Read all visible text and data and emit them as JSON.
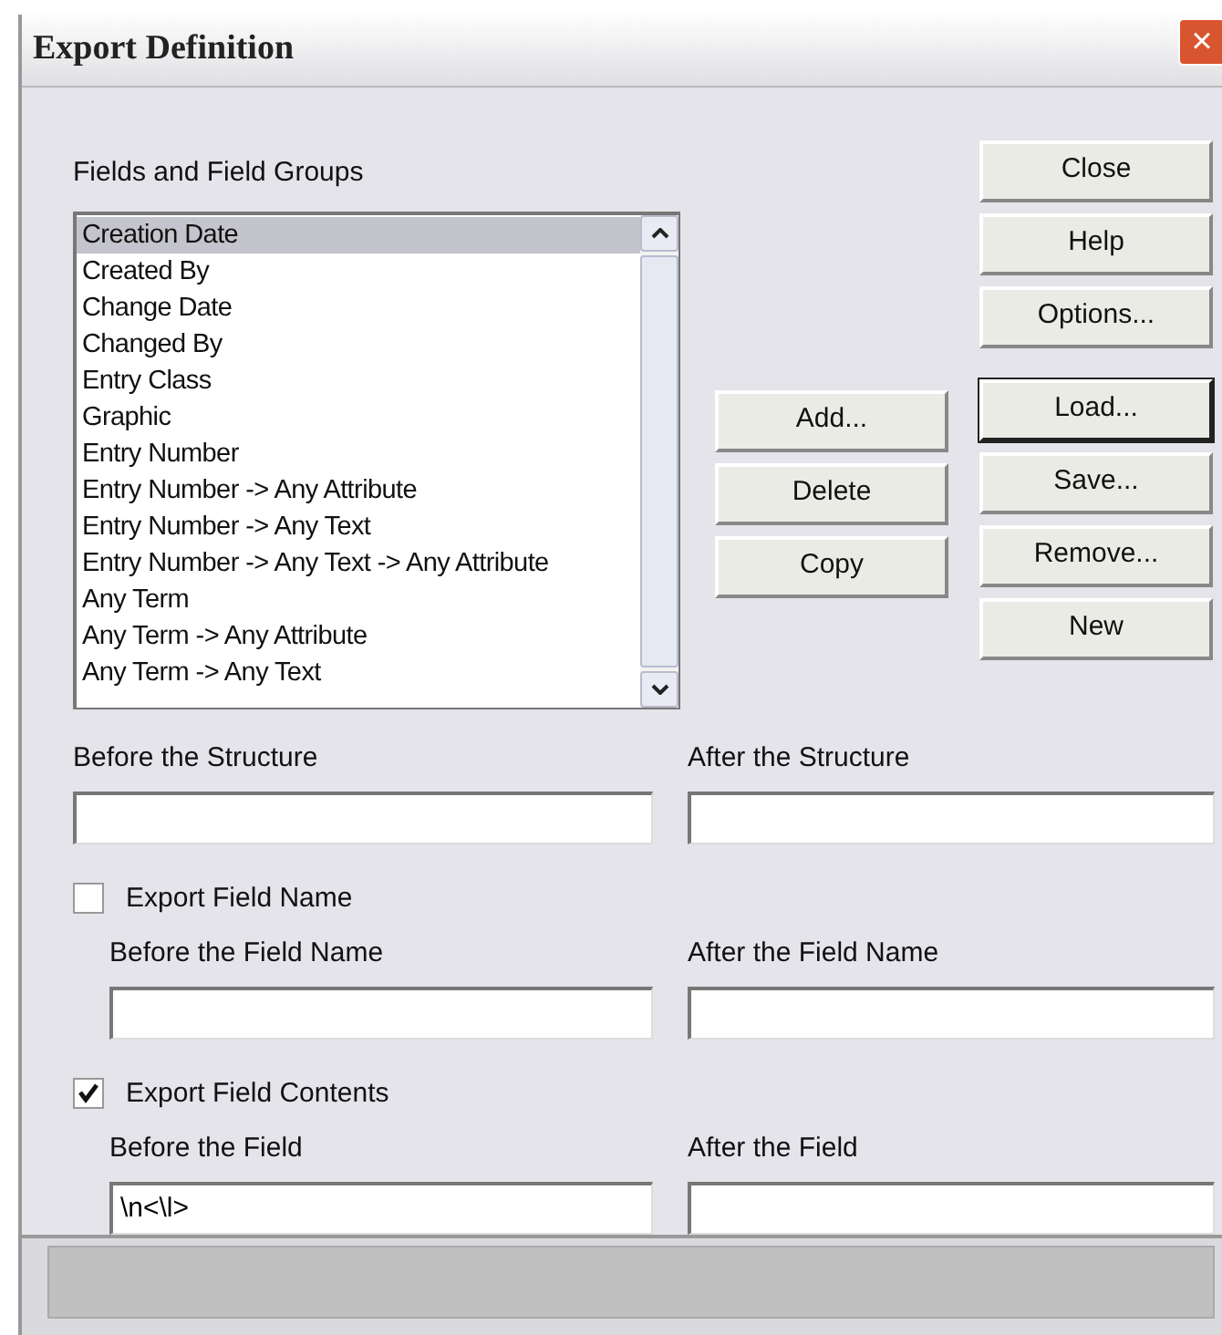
{
  "window": {
    "title": "Export Definition",
    "close": "×"
  },
  "fields_list": {
    "label": "Fields and Field Groups",
    "items": [
      {
        "text": "Creation Date",
        "selected": true
      },
      {
        "text": "Created By",
        "selected": false
      },
      {
        "text": "Change Date",
        "selected": false
      },
      {
        "text": "Changed By",
        "selected": false
      },
      {
        "text": "Entry Class",
        "selected": false
      },
      {
        "text": "Graphic",
        "selected": false
      },
      {
        "text": "Entry Number",
        "selected": false
      },
      {
        "text": "Entry Number -> Any Attribute",
        "selected": false
      },
      {
        "text": "Entry Number -> Any Text",
        "selected": false
      },
      {
        "text": "Entry Number -> Any Text -> Any Attribute",
        "selected": false
      },
      {
        "text": "Any Term",
        "selected": false
      },
      {
        "text": "Any Term -> Any Attribute",
        "selected": false
      },
      {
        "text": "Any Term -> Any Text",
        "selected": false
      }
    ]
  },
  "list_buttons": [
    {
      "label": "Add...",
      "default": false
    },
    {
      "label": "Delete",
      "default": false
    },
    {
      "label": "Copy",
      "default": false
    }
  ],
  "top_buttons": [
    {
      "label": "Close",
      "default": false
    },
    {
      "label": "Help",
      "default": false
    },
    {
      "label": "Options...",
      "default": false
    }
  ],
  "file_buttons": [
    {
      "label": "Load...",
      "default": true
    },
    {
      "label": "Save...",
      "default": false
    },
    {
      "label": "Remove...",
      "default": false
    },
    {
      "label": "New",
      "default": false
    }
  ],
  "structure": {
    "before_label": "Before the Structure",
    "after_label": "After the Structure"
  },
  "field_name": {
    "checkbox": "Export Field Name",
    "checked": false,
    "before_label": "Before the Field Name",
    "after_label": "After the Field Name"
  },
  "field_contents": {
    "checkbox": "Export Field Contents",
    "checked": true,
    "before_label": "Before the Field",
    "before_value": "\\n<\\l>",
    "after_label": "After the Field"
  }
}
